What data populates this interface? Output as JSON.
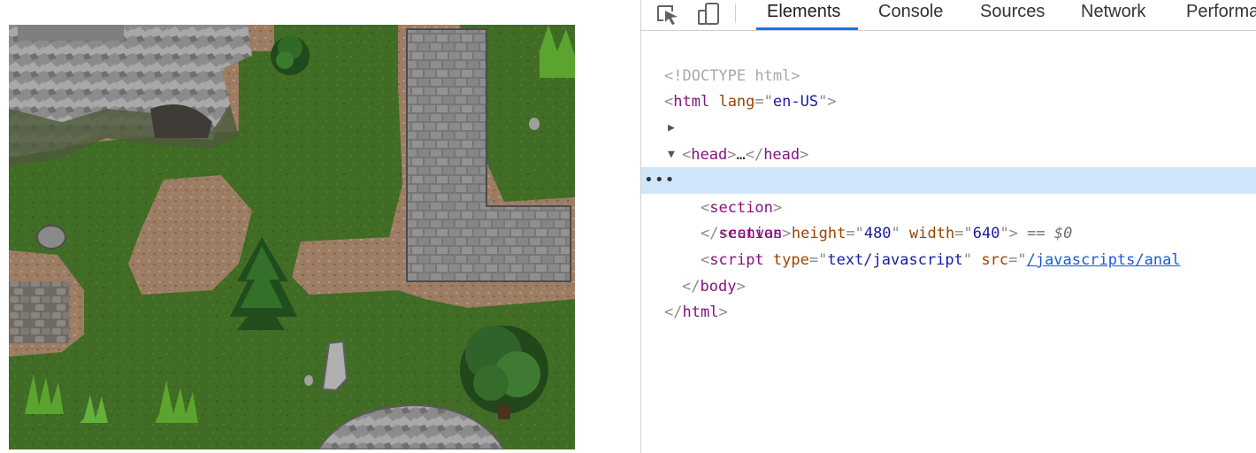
{
  "devtools": {
    "toolbar": {
      "inspect_icon": "element-picker-icon",
      "device_icon": "device-toolbar-icon",
      "tabs": [
        {
          "label": "Elements",
          "active": true
        },
        {
          "label": "Console"
        },
        {
          "label": "Sources"
        },
        {
          "label": "Network"
        },
        {
          "label": "Performa"
        }
      ]
    },
    "dom": {
      "doctype": "<!DOCTYPE html>",
      "html_tag": "html",
      "html_lang_attr": "lang",
      "html_lang_value": "en-US",
      "head_tag": "head",
      "head_ellipsis": "…",
      "body_tag": "body",
      "section_tag": "section",
      "canvas_tag": "canvas",
      "canvas_height_attr": "height",
      "canvas_height_value": "480",
      "canvas_width_attr": "width",
      "canvas_width_value": "640",
      "selected_marker": "== $0",
      "ellipsis_menu": "•••",
      "script_tag": "script",
      "script_type_attr": "type",
      "script_type_value": "text/javascript",
      "script_src_attr": "src",
      "script_src_value": "/javascripts/anal"
    },
    "colors": {
      "tag": "#881280",
      "attribute": "#994500",
      "value": "#1a1aa6",
      "selection": "#cfe6fb",
      "active_tab_underline": "#1a73e8"
    }
  },
  "game": {
    "canvas_label": "game-map",
    "scene": "top-down fantasy map with grass, dirt paths, stone wall, rocky cliffs, cave, trees and boulders"
  }
}
